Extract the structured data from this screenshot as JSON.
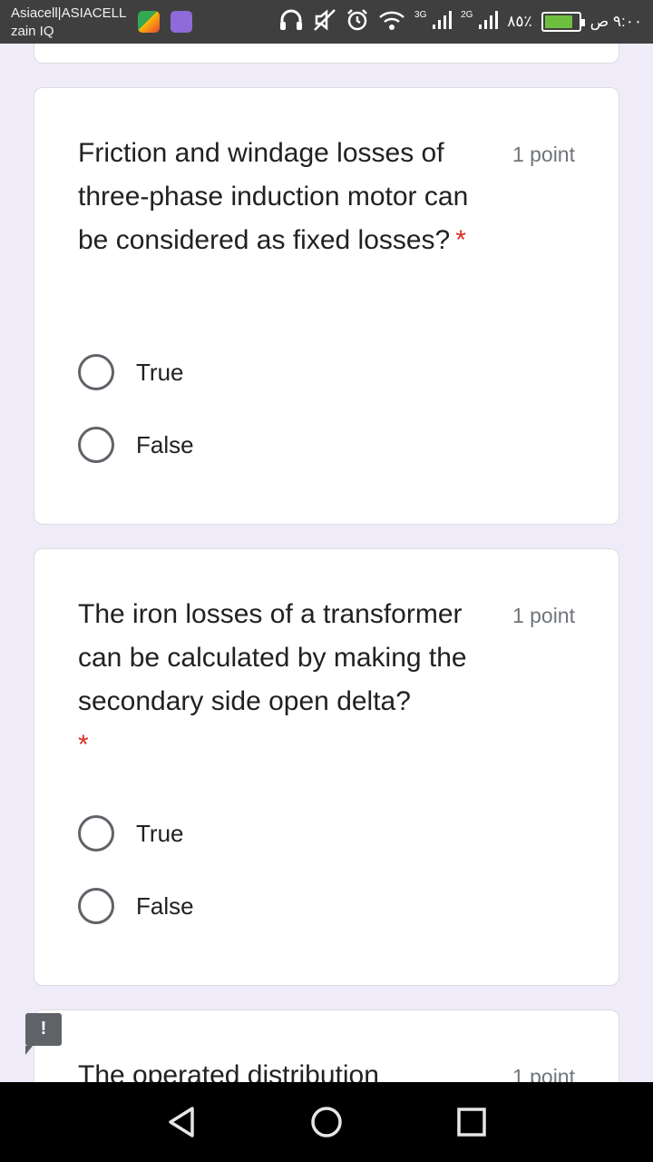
{
  "status_bar": {
    "carrier_line1": "Asiacell|ASIACELL",
    "carrier_line2": "zain IQ",
    "net1": "3G",
    "net2": "2G",
    "battery_text": "٨٥٪",
    "time": "٩:٠٠ ص",
    "battery_level": 0.85
  },
  "questions": [
    {
      "text": "Friction and windage losses of three-phase induction motor can be considered as fixed losses?",
      "required_mark": "*",
      "points": "1 point",
      "options": [
        "True",
        "False"
      ]
    },
    {
      "text": "The iron losses of a transformer can be calculated by making the secondary side open delta?",
      "required_mark": "*",
      "points": "1 point",
      "options": [
        "True",
        "False"
      ]
    },
    {
      "text": "The operated distribution",
      "points": "1 point"
    }
  ],
  "feedback_icon": "!",
  "icons": [
    "headphones-icon",
    "mute-icon",
    "alarm-icon",
    "wifi-icon",
    "signal-icon",
    "battery-icon",
    "back-icon",
    "home-icon",
    "recents-icon"
  ]
}
